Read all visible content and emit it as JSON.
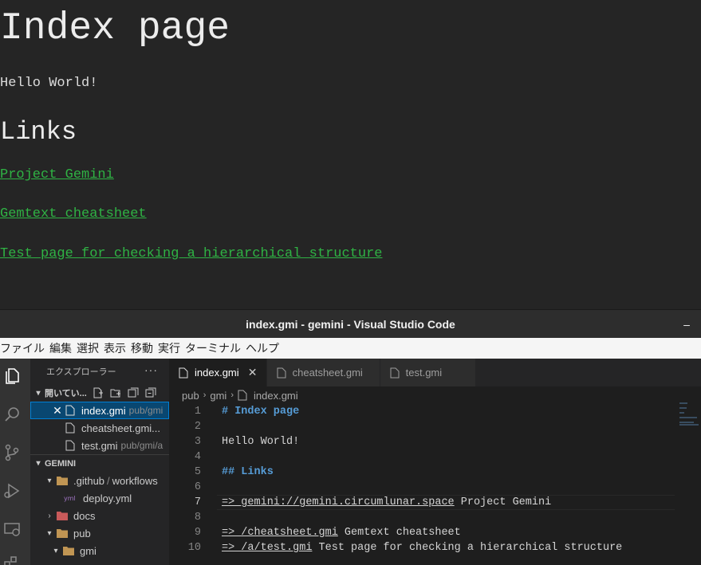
{
  "browser": {
    "heading": "Index page",
    "paragraph": "Hello World!",
    "subheading": "Links",
    "links": [
      "Project Gemini",
      "Gemtext cheatsheet",
      "Test page for checking a hierarchical structure"
    ]
  },
  "window": {
    "title": "index.gmi - gemini - Visual Studio Code",
    "minimize": "–"
  },
  "menu": [
    "ファイル",
    "編集",
    "選択",
    "表示",
    "移動",
    "実行",
    "ターミナル",
    "ヘルプ"
  ],
  "activity_icons": [
    "explorer-icon",
    "search-icon",
    "source-control-icon",
    "run-debug-icon",
    "remote-explorer-icon",
    "extensions-icon"
  ],
  "sidebar": {
    "header": "エクスプローラー",
    "more": "···",
    "open_editors_label": "開いてい...",
    "open_editors": [
      {
        "name": "index.gmi",
        "desc": "pub/gmi",
        "close": "✕"
      },
      {
        "name": "cheatsheet.gmi...",
        "desc": ""
      },
      {
        "name": "test.gmi",
        "desc": "pub/gmi/a"
      }
    ],
    "workspace_label": "GEMINI",
    "tree": [
      {
        "name": ".github",
        "suffix": "workflows",
        "sep": "/"
      },
      {
        "name": "deploy.yml"
      },
      {
        "name": "docs"
      },
      {
        "name": "pub"
      },
      {
        "name": "gmi"
      }
    ]
  },
  "tabs": [
    {
      "label": "index.gmi",
      "close": "✕"
    },
    {
      "label": "cheatsheet.gmi"
    },
    {
      "label": "test.gmi"
    }
  ],
  "breadcrumb": [
    "pub",
    "gmi",
    "index.gmi"
  ],
  "code": {
    "line_numbers": [
      "1",
      "2",
      "3",
      "4",
      "5",
      "6",
      "7",
      "8",
      "9",
      "10"
    ],
    "l1": "# Index page",
    "l3": "Hello World!",
    "l5": "## Links",
    "l7_link": "=> gemini://gemini.circumlunar.space",
    "l7_text": " Project Gemini",
    "l9_link": "=> /cheatsheet.gmi",
    "l9_text": " Gemtext cheatsheet",
    "l10_link": "=> /a/test.gmi",
    "l10_text": " Test page for checking a hierarchical structure"
  },
  "colors": {
    "link_green": "#2fb344",
    "heading_blue": "#569cd6",
    "selection": "#094771"
  }
}
